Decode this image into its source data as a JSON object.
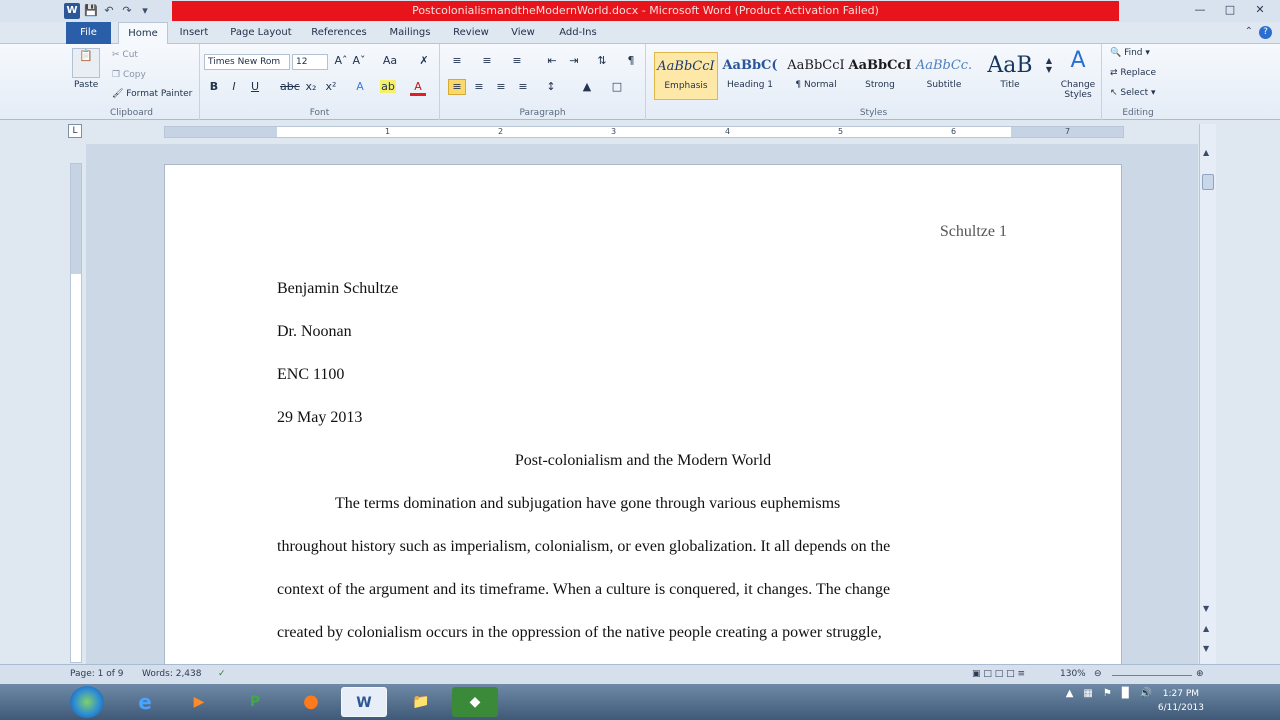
{
  "window": {
    "title": "PostcolonialismandtheModernWorld.docx - Microsoft Word (Product Activation Failed)",
    "app_logo": "W"
  },
  "tabs": [
    "File",
    "Home",
    "Insert",
    "Page Layout",
    "References",
    "Mailings",
    "Review",
    "View",
    "Add-Ins"
  ],
  "ribbon": {
    "clipboard": {
      "paste": "Paste",
      "cut": "Cut",
      "copy": "Copy",
      "format_painter": "Format Painter",
      "label": "Clipboard"
    },
    "font": {
      "name": "Times New Rom",
      "size": "12",
      "label": "Font"
    },
    "paragraph": {
      "label": "Paragraph"
    },
    "styles": {
      "label": "Styles",
      "items": [
        {
          "sample": "AaBbCcI",
          "name": "Emphasis"
        },
        {
          "sample": "AaBbC(",
          "name": "Heading 1"
        },
        {
          "sample": "AaBbCcI",
          "name": "¶ Normal"
        },
        {
          "sample": "AaBbCcI",
          "name": "Strong"
        },
        {
          "sample": "AaBbCc.",
          "name": "Subtitle"
        },
        {
          "sample": "AaB",
          "name": "Title"
        }
      ],
      "change_styles": "Change Styles"
    },
    "editing": {
      "find": "Find",
      "replace": "Replace",
      "select": "Select",
      "label": "Editing"
    }
  },
  "ruler": {
    "numbers": [
      "1",
      "2",
      "3",
      "4",
      "5",
      "6",
      "7"
    ]
  },
  "document": {
    "header": "Schultze 1",
    "lines": [
      "Benjamin Schultze",
      "Dr. Noonan",
      "ENC 1100",
      "29 May 2013"
    ],
    "title": "Post-colonialism and the Modern World",
    "body": [
      "The terms domination and subjugation have gone through various euphemisms",
      "throughout history such as imperialism, colonialism, or even globalization. It all depends on the",
      "context of the argument and its timeframe. When a culture is conquered, it changes. The change",
      "created by colonialism occurs in the oppression of the native people creating a power struggle,"
    ]
  },
  "status": {
    "page": "Page: 1 of 9",
    "words": "Words: 2,438",
    "zoom": "130%"
  },
  "taskbar": {
    "word_label": "W",
    "time": "1:27 PM",
    "date": "6/11/2013"
  }
}
